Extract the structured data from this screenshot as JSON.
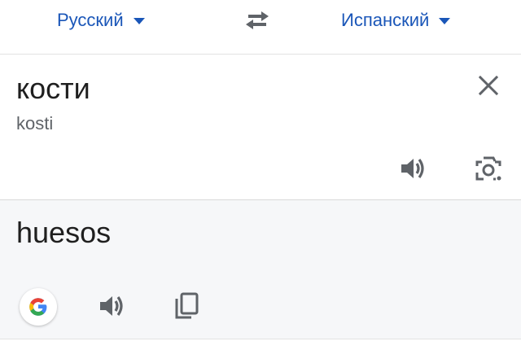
{
  "languages": {
    "source": "Русский",
    "target": "Испанский"
  },
  "source": {
    "text": "кости",
    "transliteration": "kosti"
  },
  "result": {
    "text": "huesos"
  },
  "icons": {
    "swap": "swap-arrows-icon",
    "clear": "close-icon",
    "source_speaker": "speaker-icon",
    "camera": "camera-icon",
    "google": "google-logo-icon",
    "result_speaker": "speaker-icon",
    "copy": "copy-icon"
  },
  "colors": {
    "accent": "#1a56b8",
    "icon": "#5f6368",
    "result_bg": "#f6f7f9"
  }
}
